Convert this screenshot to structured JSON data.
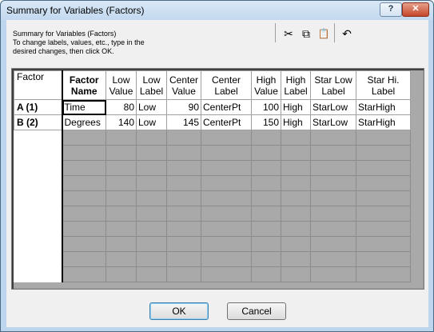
{
  "window": {
    "title": "Summary for Variables (Factors)",
    "help_label": "?",
    "close_label": "✕"
  },
  "instructions": {
    "line1": "Summary for Variables (Factors)",
    "line2": "To change labels, values, etc., type in the",
    "line3": "desired changes, then click OK."
  },
  "toolbar": {
    "cut": "✂",
    "copy": "⧉",
    "paste": "📋",
    "undo": "↶"
  },
  "table": {
    "headers": {
      "factor": "Factor",
      "factor_name": "Factor Name",
      "low_value": "Low Value",
      "low_label": "Low Label",
      "center_value": "Center Value",
      "center_label": "Center Label",
      "high_value": "High Value",
      "high_label": "High Label",
      "star_low_label": "Star Low Label",
      "star_hi_label": "Star Hi. Label"
    },
    "rows": [
      {
        "factor": "A  (1)",
        "name": "Time",
        "low_value": "80",
        "low_label": "Low",
        "center_value": "90",
        "center_label": "CenterPt",
        "high_value": "100",
        "high_label": "High",
        "star_low": "StarLow",
        "star_high": "StarHigh"
      },
      {
        "factor": "B  (2)",
        "name": "Degrees",
        "low_value": "140",
        "low_label": "Low",
        "center_value": "145",
        "center_label": "CenterPt",
        "high_value": "150",
        "high_label": "High",
        "star_low": "StarLow",
        "star_high": "StarHigh"
      }
    ]
  },
  "buttons": {
    "ok": "OK",
    "cancel": "Cancel"
  }
}
